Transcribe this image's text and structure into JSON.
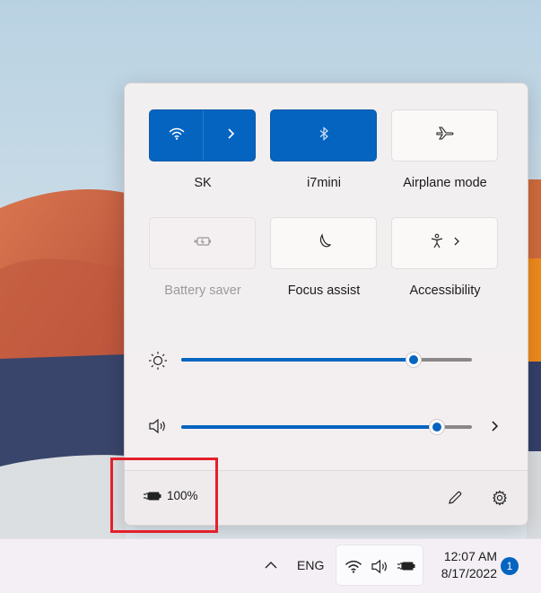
{
  "quick_settings": {
    "tiles": [
      {
        "label": "SK",
        "icon": "wifi-icon",
        "state": "on",
        "has_chevron": true
      },
      {
        "label": "i7mini",
        "icon": "bluetooth-icon",
        "state": "on"
      },
      {
        "label": "Airplane mode",
        "icon": "airplane-icon",
        "state": "off"
      },
      {
        "label": "Battery saver",
        "icon": "battery-saver-icon",
        "state": "disabled"
      },
      {
        "label": "Focus assist",
        "icon": "moon-icon",
        "state": "off"
      },
      {
        "label": "Accessibility",
        "icon": "accessibility-icon",
        "state": "off",
        "has_chevron": true
      }
    ],
    "brightness": {
      "icon": "sun-icon",
      "level_percent": 80
    },
    "volume": {
      "icon": "speaker-icon",
      "level_percent": 88
    },
    "battery": {
      "icon": "battery-plugged-icon",
      "text": "100%"
    },
    "footer_icons": [
      "edit-pencil-icon",
      "gear-icon"
    ]
  },
  "taskbar": {
    "chevron_icon": "chevron-up-icon",
    "language": "ENG",
    "tray_icons": [
      "wifi-icon",
      "speaker-icon",
      "battery-plugged-icon"
    ],
    "time": "12:07 AM",
    "date": "8/17/2022",
    "notification_count": "1"
  },
  "colors": {
    "accent": "#0564c0",
    "highlight_box": "#e3202b"
  }
}
